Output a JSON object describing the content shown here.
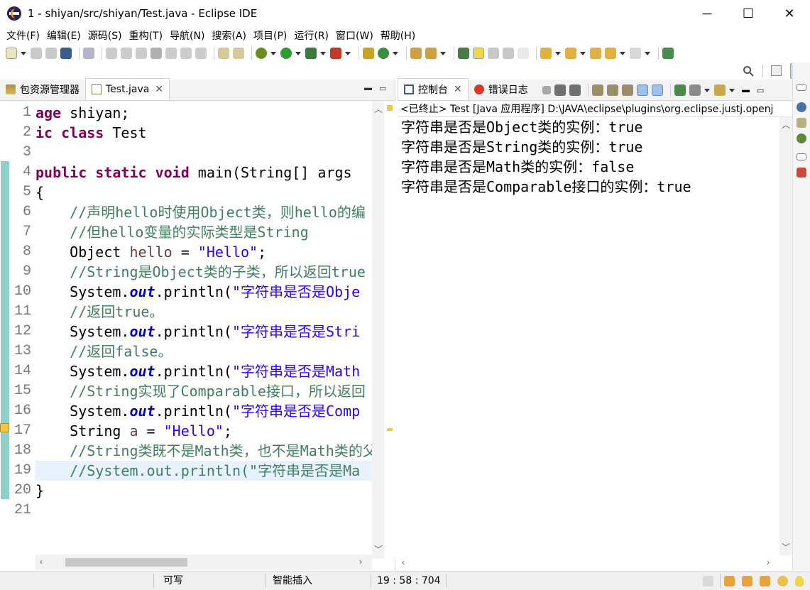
{
  "window": {
    "title": "1 - shiyan/src/shiyan/Test.java - Eclipse IDE",
    "minimize": "─",
    "maximize": "☐",
    "close": "✕"
  },
  "menu": [
    "文件(F)",
    "编辑(E)",
    "源码(S)",
    "重构(T)",
    "导航(N)",
    "搜索(A)",
    "项目(P)",
    "运行(R)",
    "窗口(W)",
    "帮助(H)"
  ],
  "editor": {
    "tabs": [
      {
        "label": "包资源管理器"
      },
      {
        "label": "Test.java",
        "close": "✕"
      }
    ],
    "line_numbers": [
      "1",
      "2",
      "3",
      "4",
      "5",
      "6",
      "7",
      "8",
      "9",
      "10",
      "11",
      "12",
      "13",
      "14",
      "15",
      "16",
      "17",
      "18",
      "19",
      "20",
      "21"
    ],
    "lines": [
      [
        {
          "t": "kw",
          "v": "age"
        },
        {
          "t": "plain",
          "v": " shiyan;"
        }
      ],
      [
        {
          "t": "kw",
          "v": "ic class"
        },
        {
          "t": "plain",
          "v": " Test"
        }
      ],
      [],
      [
        {
          "t": "kw",
          "v": "public static void"
        },
        {
          "t": "plain",
          "v": " main(String[] args"
        }
      ],
      [
        {
          "t": "plain",
          "v": "{"
        }
      ],
      [
        {
          "t": "plain",
          "v": "    "
        },
        {
          "t": "cm",
          "v": "//声明hello时使用Object类，则hello的编"
        }
      ],
      [
        {
          "t": "plain",
          "v": "    "
        },
        {
          "t": "cm",
          "v": "//但hello变量的实际类型是String"
        }
      ],
      [
        {
          "t": "plain",
          "v": "    Object "
        },
        {
          "t": "var",
          "v": "hello"
        },
        {
          "t": "plain",
          "v": " = "
        },
        {
          "t": "str",
          "v": "\"Hello\""
        },
        {
          "t": "plain",
          "v": ";"
        }
      ],
      [
        {
          "t": "plain",
          "v": "    "
        },
        {
          "t": "cm",
          "v": "//String是Object类的子类，所以返回true"
        }
      ],
      [
        {
          "t": "plain",
          "v": "    System."
        },
        {
          "t": "fld",
          "v": "out"
        },
        {
          "t": "plain",
          "v": ".println("
        },
        {
          "t": "str",
          "v": "\"字符串是否是Obje"
        }
      ],
      [
        {
          "t": "plain",
          "v": "    "
        },
        {
          "t": "cm",
          "v": "//返回true。"
        }
      ],
      [
        {
          "t": "plain",
          "v": "    System."
        },
        {
          "t": "fld",
          "v": "out"
        },
        {
          "t": "plain",
          "v": ".println("
        },
        {
          "t": "str",
          "v": "\"字符串是否是Stri"
        }
      ],
      [
        {
          "t": "plain",
          "v": "    "
        },
        {
          "t": "cm",
          "v": "//返回false。"
        }
      ],
      [
        {
          "t": "plain",
          "v": "    System."
        },
        {
          "t": "fld",
          "v": "out"
        },
        {
          "t": "plain",
          "v": ".println("
        },
        {
          "t": "str",
          "v": "\"字符串是否是Math"
        }
      ],
      [
        {
          "t": "plain",
          "v": "    "
        },
        {
          "t": "cm",
          "v": "//String实现了Comparable接口，所以返回"
        }
      ],
      [
        {
          "t": "plain",
          "v": "    System."
        },
        {
          "t": "fld",
          "v": "out"
        },
        {
          "t": "plain",
          "v": ".println("
        },
        {
          "t": "str",
          "v": "\"字符串是否是Comp"
        }
      ],
      [
        {
          "t": "plain",
          "v": "    String "
        },
        {
          "t": "var",
          "v": "a"
        },
        {
          "t": "plain",
          "v": " = "
        },
        {
          "t": "str",
          "v": "\"Hello\""
        },
        {
          "t": "plain",
          "v": ";"
        }
      ],
      [
        {
          "t": "plain",
          "v": "    "
        },
        {
          "t": "cm",
          "v": "//String类既不是Math类，也不是Math类的父"
        }
      ],
      [
        {
          "t": "plain",
          "v": "    "
        },
        {
          "t": "cm",
          "v": "//System.out.println(\"字符串是否是Ma"
        }
      ],
      [
        {
          "t": "plain",
          "v": "}"
        }
      ],
      []
    ]
  },
  "console": {
    "tabs": [
      {
        "label": "控制台",
        "close": "✕"
      },
      {
        "label": "错误日志"
      }
    ],
    "header": "<已终止> Test [Java 应用程序] D:\\JAVA\\eclipse\\plugins\\org.eclipse.justj.openj",
    "output": [
      "字符串是否是Object类的实例：true",
      "字符串是否是String类的实例：true",
      "字符串是否是Math类的实例：false",
      "字符串是否是Comparable接口的实例：true"
    ]
  },
  "status": {
    "writable": "可写",
    "insert_mode": "智能插入",
    "position": "19 : 58 : 704"
  },
  "colors": {
    "keyword": "#7f0055",
    "comment": "#3f7f5f",
    "string": "#2a00ff",
    "field": "#0000c0",
    "local_var": "#6a3e3e",
    "line_number": "#787878",
    "current_line": "#e8f2fe"
  }
}
